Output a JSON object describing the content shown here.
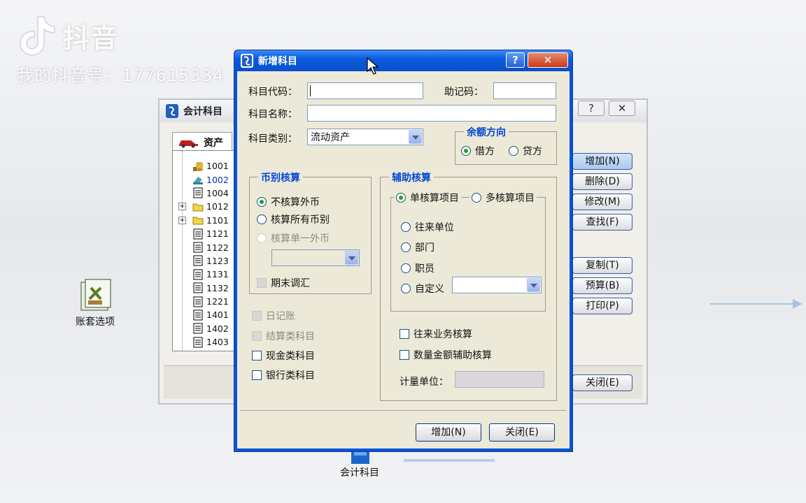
{
  "watermark": {
    "brand": "抖音",
    "account": "我的抖音号：177615334"
  },
  "desktop": {
    "icon_ledger_options": "账套选项",
    "icon_accounts": "会计科目"
  },
  "back_window": {
    "title": "会计科目",
    "help_label": "?",
    "close_label": "✕",
    "tab_label": "资产",
    "tree_codes": [
      "1001",
      "1002",
      "1004",
      "1012",
      "1101",
      "1121",
      "1122",
      "1123",
      "1131",
      "1132",
      "1221",
      "1401",
      "1402",
      "1403"
    ],
    "buttons": {
      "add": "增加(N)",
      "delete": "删除(D)",
      "modify": "修改(M)",
      "find": "查找(F)",
      "copy": "复制(T)",
      "budget": "预算(B)",
      "print": "打印(P)",
      "close": "关闭(E)"
    }
  },
  "dialog": {
    "title": "新增科目",
    "help_label": "?",
    "close_label": "✕",
    "code_label": "科目代码：",
    "code_value": "",
    "memo_label": "助记码：",
    "memo_value": "",
    "name_label": "科目名称：",
    "name_value": "",
    "category_label": "科目类别：",
    "category_value": "流动资产",
    "balance_group": "余额方向",
    "debit": "借方",
    "credit": "贷方",
    "currency_group": "币别核算",
    "no_foreign": "不核算外币",
    "all_currencies": "核算所有币别",
    "single_foreign": "核算单一外币",
    "period_end_adjust": "期末调汇",
    "journal": "日记账",
    "settlement": "结算类科目",
    "cash": "现金类科目",
    "bank": "银行类科目",
    "aux_group": "辅助核算",
    "single_item": "单核算项目",
    "multi_item": "多核算项目",
    "aux_items": [
      "往来单位",
      "部门",
      "职员",
      "自定义"
    ],
    "ar_ap": "往来业务核算",
    "quantity": "数量金额辅助核算",
    "unit_label": "计量单位：",
    "add_button": "增加(N)",
    "close_button": "关闭(E)"
  }
}
